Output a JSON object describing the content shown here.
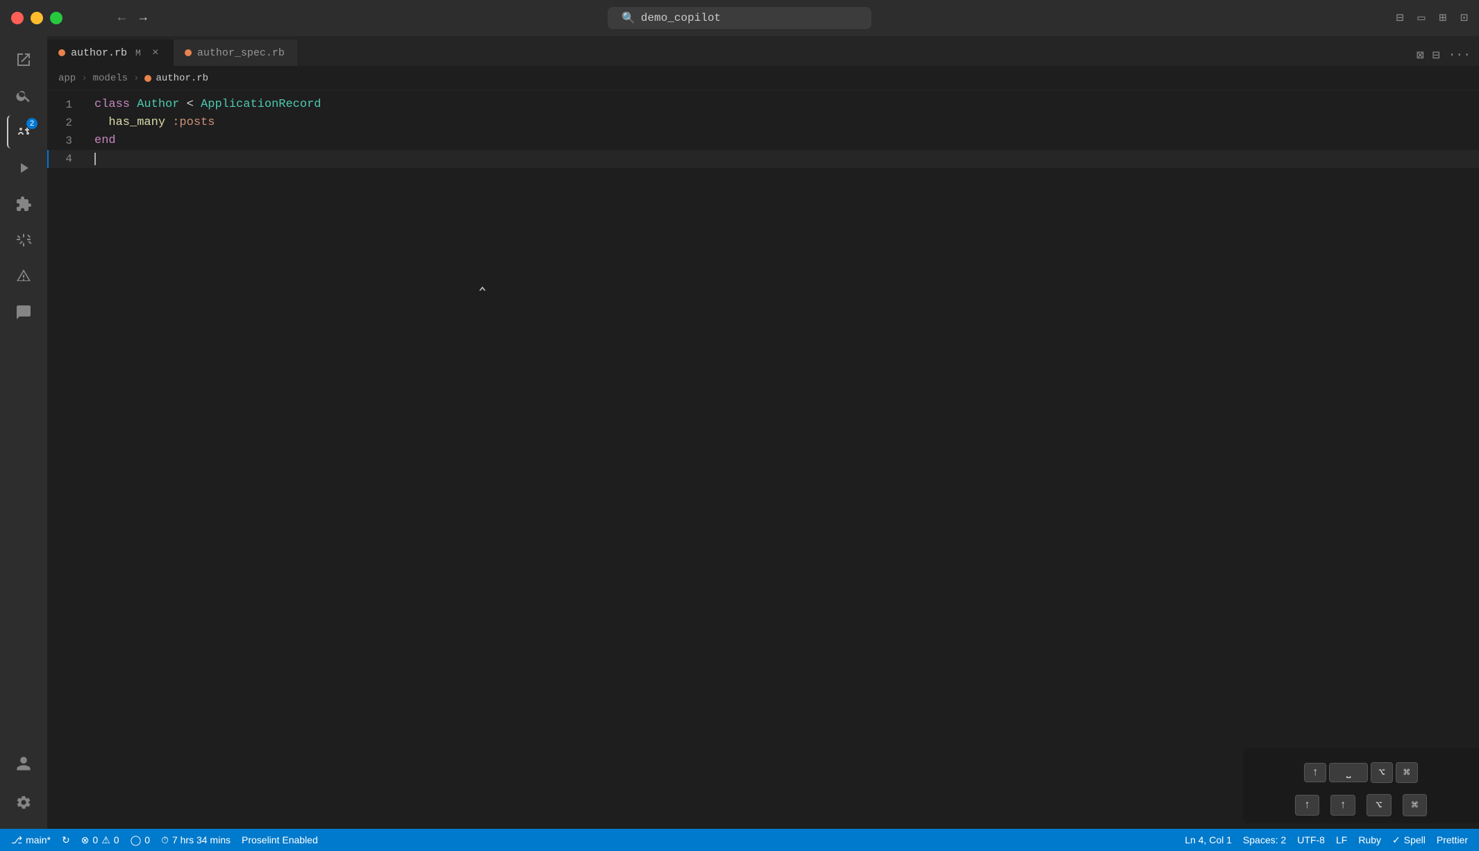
{
  "window": {
    "title": "demo_copilot"
  },
  "titlebar": {
    "search_placeholder": "demo_copilot",
    "nav_back": "←",
    "nav_forward": "→"
  },
  "tabs": [
    {
      "id": "author-rb",
      "label": "author.rb",
      "modified": true,
      "active": true,
      "dot_color": "#e8834d"
    },
    {
      "id": "author-spec-rb",
      "label": "author_spec.rb",
      "modified": false,
      "active": false
    }
  ],
  "breadcrumb": {
    "parts": [
      "app",
      "models",
      "author.rb"
    ]
  },
  "code": {
    "lines": [
      {
        "number": 1,
        "content": "class Author < ApplicationRecord",
        "active": false
      },
      {
        "number": 2,
        "content": "  has_many :posts",
        "active": false
      },
      {
        "number": 3,
        "content": "end",
        "active": false
      },
      {
        "number": 4,
        "content": "",
        "active": true
      }
    ]
  },
  "statusbar": {
    "branch": "main*",
    "sync": "↻",
    "errors": "0",
    "warnings": "0",
    "remote_errors": "0",
    "time": "7 hrs 34 mins",
    "proselint": "Proselint Enabled",
    "cursor_pos": "Ln 4, Col 1",
    "spaces": "Spaces: 2",
    "encoding": "UTF-8",
    "line_ending": "LF",
    "language": "Ruby",
    "spell": "Spell",
    "prettier": "Prettier"
  },
  "floating_panel": {
    "keys": [
      "↑",
      "↑",
      "⌥",
      "⌘"
    ],
    "space_label": "⎵",
    "actions": [
      "↑",
      "↑",
      "⌥",
      "⌘"
    ]
  },
  "activity_bar": {
    "items": [
      {
        "id": "explorer",
        "icon": "files",
        "active": false
      },
      {
        "id": "search",
        "icon": "search",
        "active": false
      },
      {
        "id": "source-control",
        "icon": "source-control",
        "active": true,
        "badge": 2
      },
      {
        "id": "run-debug",
        "icon": "run",
        "active": false
      },
      {
        "id": "extensions",
        "icon": "extensions",
        "active": false
      },
      {
        "id": "docker",
        "icon": "docker",
        "active": false
      },
      {
        "id": "prism",
        "icon": "prism",
        "active": false
      },
      {
        "id": "chat",
        "icon": "chat",
        "active": false
      }
    ],
    "bottom": [
      {
        "id": "account",
        "icon": "account"
      },
      {
        "id": "settings",
        "icon": "settings"
      }
    ]
  }
}
